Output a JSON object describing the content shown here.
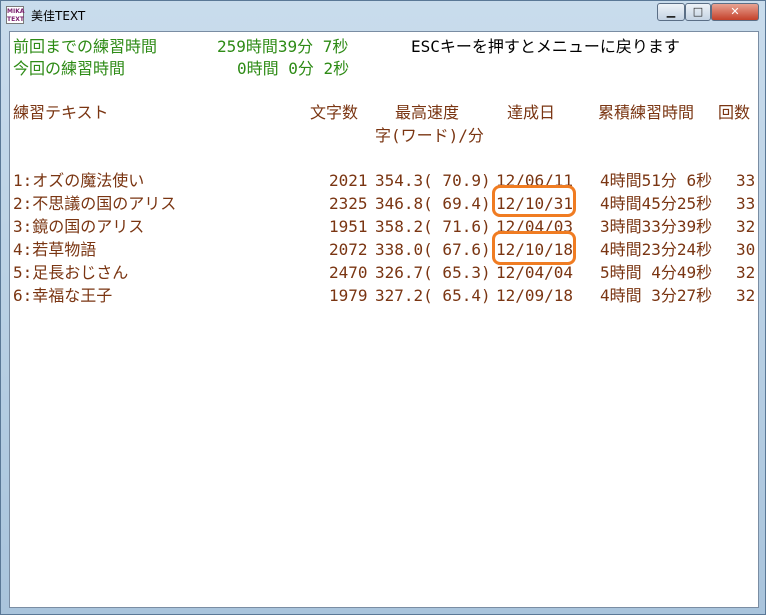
{
  "window": {
    "title": "美佳TEXT",
    "icon_text": [
      "MIKA",
      "TEXT"
    ],
    "controls": {
      "minimize": "▁",
      "maximize": "□",
      "close": "✕"
    }
  },
  "summary": {
    "prev_label": "前回までの練習時間",
    "prev_value": "259時間39分 7秒",
    "cur_label": "今回の練習時間",
    "cur_value": "0時間 0分 2秒",
    "esc_hint": "ESCキーを押すとメニューに戻ります"
  },
  "headers": {
    "text": "練習テキスト",
    "chars": "文字数",
    "speed": "最高速度",
    "unit": "字(ワード)/分",
    "date": "達成日",
    "time": "累積練習時間",
    "count": "回数"
  },
  "rows": [
    {
      "name": "1:オズの魔法使い",
      "chars": "2021",
      "speed": "354.3( 70.9)",
      "date": "12/06/11",
      "time": "4時間51分 6秒",
      "count": "33"
    },
    {
      "name": "2:不思議の国のアリス",
      "chars": "2325",
      "speed": "346.8( 69.4)",
      "date": "12/10/31",
      "time": "4時間45分25秒",
      "count": "33"
    },
    {
      "name": "3:鏡の国のアリス",
      "chars": "1951",
      "speed": "358.2( 71.6)",
      "date": "12/04/03",
      "time": "3時間33分39秒",
      "count": "32"
    },
    {
      "name": "4:若草物語",
      "chars": "2072",
      "speed": "338.0( 67.6)",
      "date": "12/10/18",
      "time": "4時間23分24秒",
      "count": "30"
    },
    {
      "name": "5:足長おじさん",
      "chars": "2470",
      "speed": "326.7( 65.3)",
      "date": "12/04/04",
      "time": "5時間 4分49秒",
      "count": "32"
    },
    {
      "name": "6:幸福な王子",
      "chars": "1979",
      "speed": "327.2( 65.4)",
      "date": "12/09/18",
      "time": "4時間 3分27秒",
      "count": "32"
    }
  ],
  "highlighted_dates": [
    "12/10/31",
    "12/10/18"
  ],
  "colors": {
    "summary": "#2e8b16",
    "rows": "#7a3512",
    "highlight": "#f07c22"
  }
}
